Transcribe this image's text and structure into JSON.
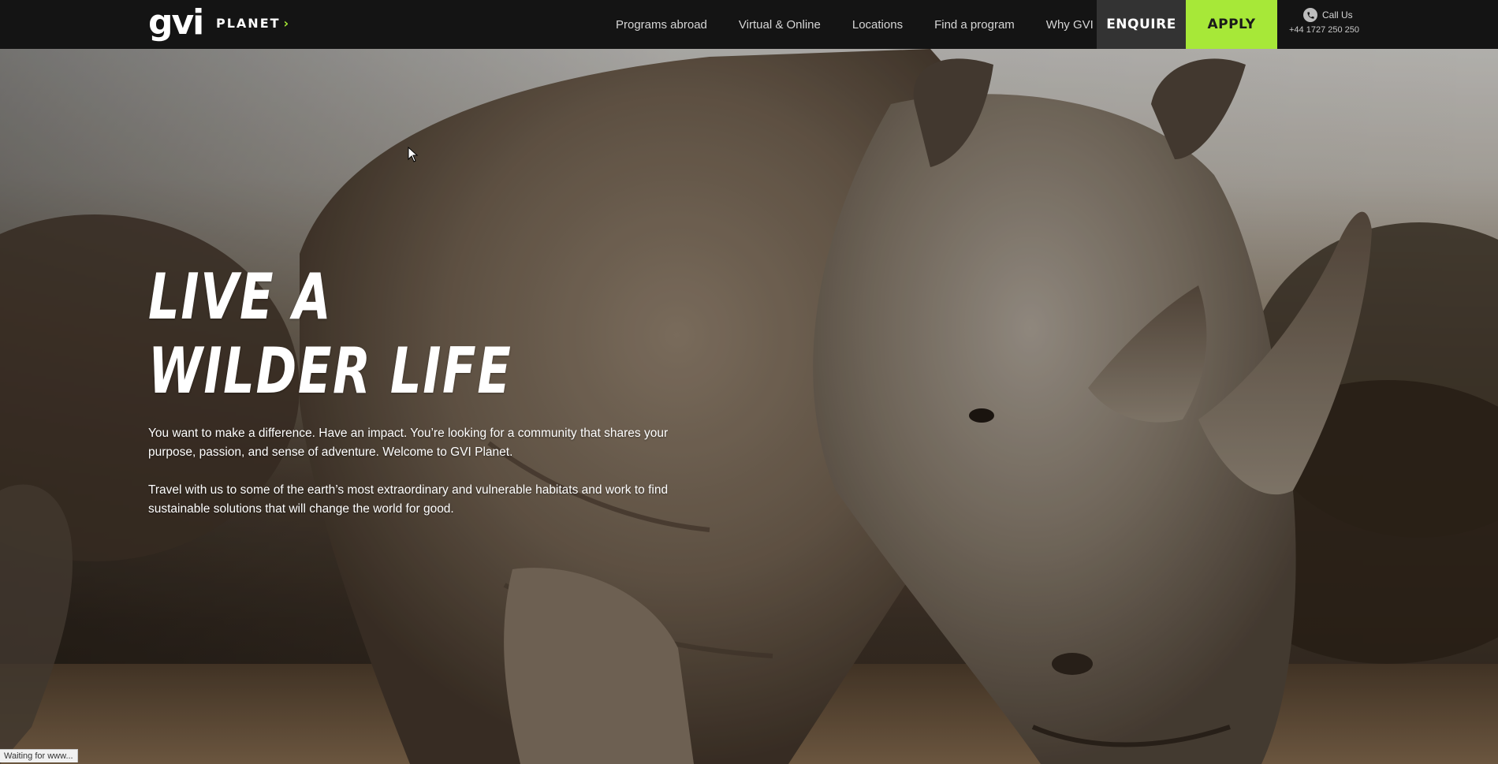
{
  "nav": {
    "logo_text": "gvi",
    "planet_label": "PLANET",
    "planet_chevron": "›",
    "links": [
      {
        "label": "Programs abroad"
      },
      {
        "label": "Virtual & Online"
      },
      {
        "label": "Locations"
      },
      {
        "label": "Find a program"
      },
      {
        "label": "Why GVI"
      }
    ],
    "enquire_label": "ENQUIRE",
    "apply_label": "APPLY",
    "call_label": "Call Us",
    "call_number": "+44 1727 250 250",
    "phone_icon": "phone-icon",
    "colors": {
      "bar": "#141414",
      "enquire_bg": "#333333",
      "apply_bg": "#a7e838",
      "accent": "#a5e635"
    }
  },
  "hero": {
    "title_line1": "LIVE A",
    "title_line2": "WILDER LIFE",
    "paragraph1": "You want to make a difference. Have an impact. You’re looking for a community that shares your purpose, passion, and sense of adventure. Welcome to GVI Planet.",
    "paragraph2": "Travel with us to some of the earth’s most extraordinary and vulnerable habitats and work to find sustainable solutions that will change the world for good.",
    "image_subject": "rhino-photo"
  },
  "status_bar": {
    "text": "Waiting for www..."
  }
}
